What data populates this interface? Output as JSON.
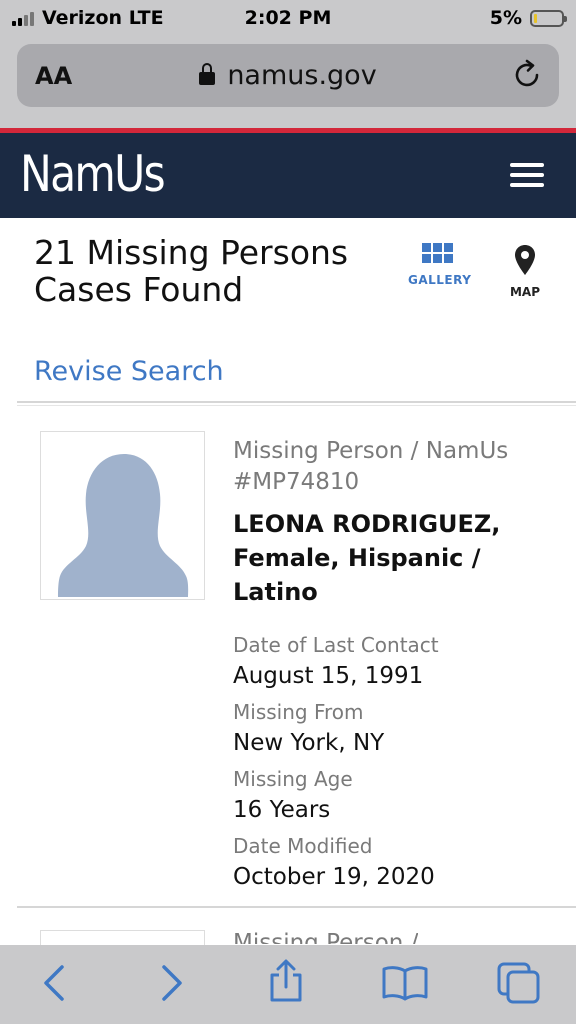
{
  "status": {
    "carrier": "Verizon LTE",
    "time": "2:02 PM",
    "battery": "5%",
    "battery_level": 0.05
  },
  "browser": {
    "text_size": "AA",
    "url": "namus.gov"
  },
  "site": {
    "logo": "NamUs"
  },
  "results": {
    "title": "21 Missing Persons Cases Found",
    "revise": "Revise Search",
    "gallery_label": "GALLERY",
    "map_label": "MAP"
  },
  "cases": [
    {
      "type": "Missing Person / NamUs #MP74810",
      "name": "LEONA RODRIGUEZ, Female, Hispanic / Latino",
      "fields": [
        {
          "label": "Date of Last Contact",
          "value": "August 15, 1991"
        },
        {
          "label": "Missing From",
          "value": "New York, NY"
        },
        {
          "label": "Missing Age",
          "value": "16 Years"
        },
        {
          "label": "Date Modified",
          "value": "October 19, 2020"
        }
      ]
    },
    {
      "type": "Missing Person /"
    }
  ],
  "colors": {
    "nav": "#1b2a43",
    "accent": "#3f78c4",
    "red": "#d2273a",
    "silhouette": "#a0b2cc"
  }
}
